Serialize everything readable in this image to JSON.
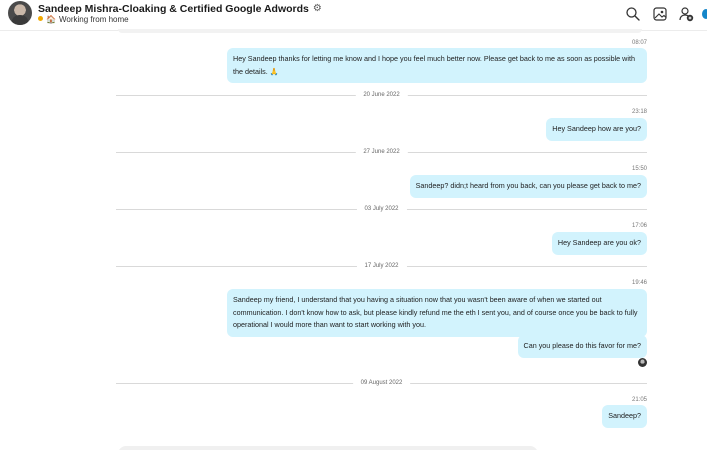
{
  "header": {
    "contact_name": "Sandeep Mishra-Cloaking & Certified Google Adwords",
    "status_text": "Working from home",
    "icons": [
      "search-icon",
      "gallery-icon",
      "add-person-icon"
    ]
  },
  "messages": [
    {
      "time": "08:07",
      "text": "Hey Sandeep thanks for letting me know and I hope you feel much better now. Please get back to me as soon as possible with the details. 🙏"
    },
    {
      "separator": "20 June 2022"
    },
    {
      "time": "23:18",
      "text": "Hey Sandeep how are you?"
    },
    {
      "separator": "27 June 2022"
    },
    {
      "time": "15:50",
      "text": "Sandeep? didn;t heard from you back, can you please get back to me?"
    },
    {
      "separator": "03 July 2022"
    },
    {
      "time": "17:06",
      "text": "Hey Sandeep are you ok?"
    },
    {
      "separator": "17 July 2022"
    },
    {
      "time": "19:46",
      "text": "Sandeep my friend, I understand that you having a situation now that you wasn't been aware of when we started out communication. I don't know how to ask, but please kindly refund me the eth I sent you, and of course once you be back to fully operational I would more than want to start working with you."
    },
    {
      "text": "Can you please do this favor for me?"
    },
    {
      "separator": "09 August 2022"
    },
    {
      "time": "21:05",
      "text": "Sandeep?"
    }
  ],
  "colors": {
    "bubble": "#d2f3fd",
    "status_dot": "#f2a900",
    "accent": "#1586c9"
  }
}
